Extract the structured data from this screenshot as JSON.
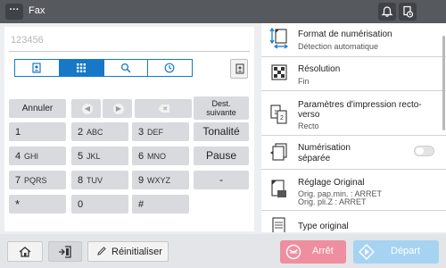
{
  "header": {
    "menu_label": "···",
    "title": "Fax",
    "bell_icon": "bell-icon",
    "status_icon": "job-status-icon"
  },
  "destination": {
    "placeholder": "123456"
  },
  "tabs": [
    {
      "icon": "address-book-icon",
      "active": false
    },
    {
      "icon": "keypad-icon",
      "active": true
    },
    {
      "icon": "search-icon",
      "active": false
    },
    {
      "icon": "history-icon",
      "active": false
    }
  ],
  "keypad": {
    "cancel": "Annuler",
    "dest_next_line1": "Dest.",
    "dest_next_line2": "suivante",
    "keys": [
      {
        "num": "1",
        "sub": ""
      },
      {
        "num": "2",
        "sub": "ABC"
      },
      {
        "num": "3",
        "sub": "DEF"
      },
      {
        "num": "4",
        "sub": "GHI"
      },
      {
        "num": "5",
        "sub": "JKL"
      },
      {
        "num": "6",
        "sub": "MNO"
      },
      {
        "num": "7",
        "sub": "PQRS"
      },
      {
        "num": "8",
        "sub": "TUV"
      },
      {
        "num": "9",
        "sub": "WXYZ"
      },
      {
        "num": "*",
        "sub": ""
      },
      {
        "num": "0",
        "sub": ""
      },
      {
        "num": "#",
        "sub": ""
      }
    ],
    "tonalite": "Tonalité",
    "pause": "Pause",
    "dash": "-"
  },
  "settings": [
    {
      "name": "Format de numérisation",
      "value": "Détection automatique"
    },
    {
      "name": "Résolution",
      "value": "Fin"
    },
    {
      "name_line1": "Paramètres d'impression recto-",
      "name_line2": "verso",
      "value": "Recto"
    },
    {
      "name_line1": "Numérisation",
      "name_line2": "séparée",
      "toggle": false
    },
    {
      "name": "Réglage Original",
      "value_line1": "Orig. pap.min. : ARRET",
      "value_line2": "Orig. pli.Z : ARRET"
    },
    {
      "name": "Type original"
    }
  ],
  "bottom": {
    "reset_label": "Réinitialiser",
    "stop_label": "Arrêt",
    "start_label": "Départ"
  },
  "colors": {
    "accent": "#1778c8",
    "stop": "#ee8e9f",
    "start": "#a6d3f2",
    "titlebar": "#565a5f"
  }
}
